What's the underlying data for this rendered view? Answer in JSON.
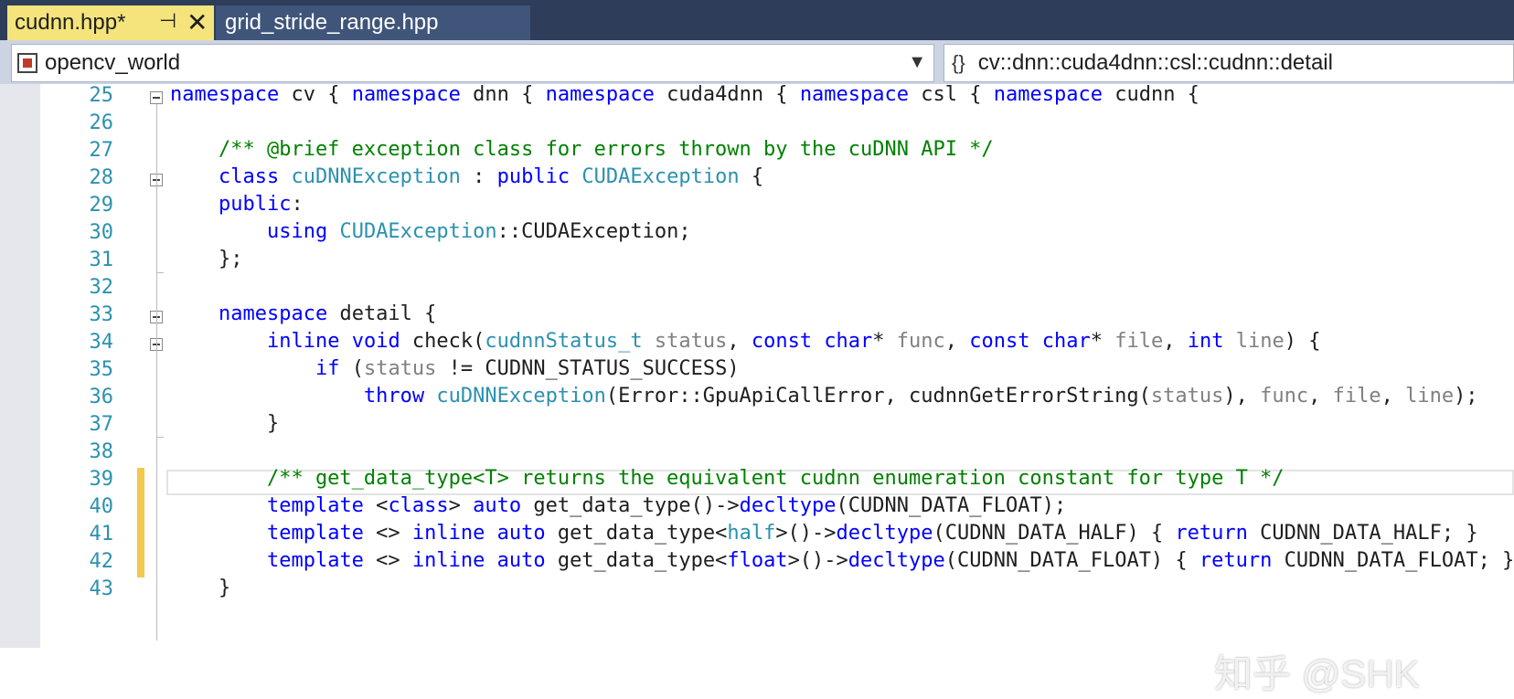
{
  "tabs": [
    {
      "label": "cudnn.hpp*",
      "active": true,
      "pin_icon": "pin-icon",
      "close_icon": "close-icon"
    },
    {
      "label": "grid_stride_range.hpp",
      "active": false
    }
  ],
  "navbar": {
    "project": "opencv_world",
    "scope": "cv::dnn::cuda4dnn::csl::cudnn::detail"
  },
  "line_numbers": [
    "25",
    "26",
    "27",
    "28",
    "29",
    "30",
    "31",
    "32",
    "33",
    "34",
    "35",
    "36",
    "37",
    "38",
    "39",
    "40",
    "41",
    "42",
    "43"
  ],
  "code_lines": [
    "namespace cv { namespace dnn { namespace cuda4dnn { namespace csl { namespace cudnn {",
    "",
    "    /** @brief exception class for errors thrown by the cuDNN API */",
    "    class cuDNNException : public CUDAException {",
    "    public:",
    "        using CUDAException::CUDAException;",
    "    };",
    "",
    "    namespace detail {",
    "        inline void check(cudnnStatus_t status, const char* func, const char* file, int line) {",
    "            if (status != CUDNN_STATUS_SUCCESS)",
    "                throw cuDNNException(Error::GpuApiCallError, cudnnGetErrorString(status), func, file, line);",
    "        }",
    "",
    "        /** get_data_type<T> returns the equivalent cudnn enumeration constant for type T */",
    "        template <class> auto get_data_type()->decltype(CUDNN_DATA_FLOAT);",
    "        template <> inline auto get_data_type<half>()->decltype(CUDNN_DATA_HALF) { return CUDNN_DATA_HALF; }",
    "        template <> inline auto get_data_type<float>()->decltype(CUDNN_DATA_FLOAT) { return CUDNN_DATA_FLOAT; }",
    "    }"
  ],
  "watermark": "知乎 @SHK",
  "colors": {
    "keyword": "#0000ff",
    "type": "#2b91af",
    "comment": "#008000",
    "param": "#808080",
    "line_number": "#2b91af",
    "change_bar": "#f2c94c",
    "active_tab": "#f5e47c"
  }
}
